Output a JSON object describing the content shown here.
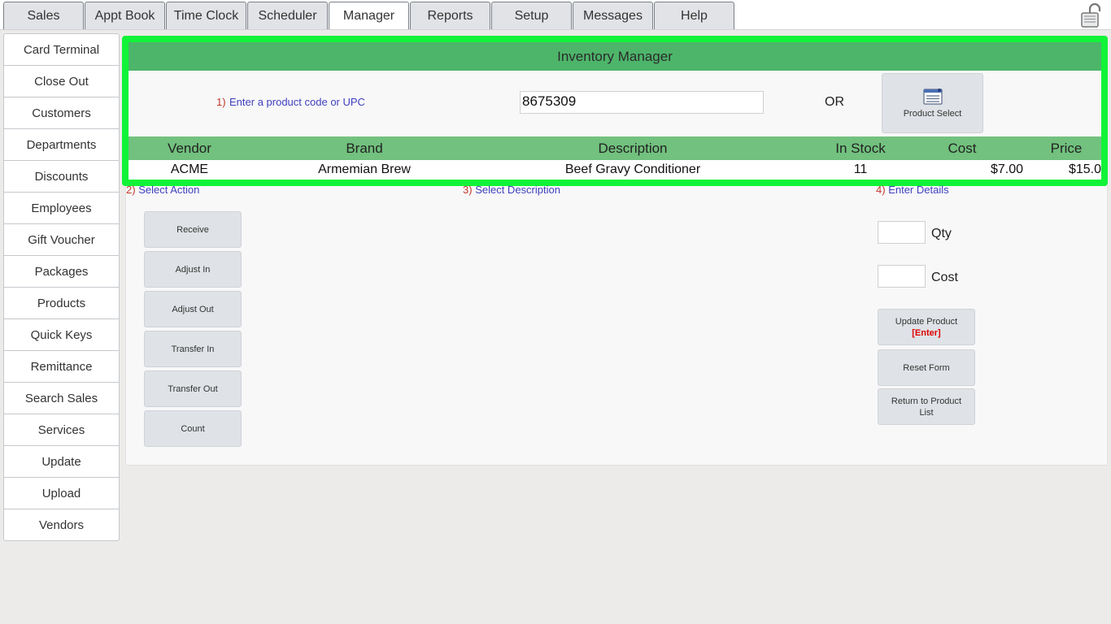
{
  "tabs": [
    {
      "label": "Sales",
      "active": false
    },
    {
      "label": "Appt Book",
      "active": false
    },
    {
      "label": "Time Clock",
      "active": false
    },
    {
      "label": "Scheduler",
      "active": false
    },
    {
      "label": "Manager",
      "active": true
    },
    {
      "label": "Reports",
      "active": false
    },
    {
      "label": "Setup",
      "active": false
    },
    {
      "label": "Messages",
      "active": false
    },
    {
      "label": "Help",
      "active": false
    }
  ],
  "sidebar": {
    "items": [
      {
        "label": "Card Terminal"
      },
      {
        "label": "Close Out"
      },
      {
        "label": "Customers"
      },
      {
        "label": "Departments"
      },
      {
        "label": "Discounts"
      },
      {
        "label": "Employees"
      },
      {
        "label": "Gift Voucher"
      },
      {
        "label": "Packages"
      },
      {
        "label": "Products"
      },
      {
        "label": "Quick Keys"
      },
      {
        "label": "Remittance"
      },
      {
        "label": "Search Sales"
      },
      {
        "label": "Services"
      },
      {
        "label": "Update"
      },
      {
        "label": "Upload"
      },
      {
        "label": "Vendors"
      }
    ]
  },
  "inventory": {
    "title": "Inventory Manager",
    "step1_num": "1)",
    "step1_text": "Enter a product code or UPC",
    "code_value": "8675309",
    "or_label": "OR",
    "product_select_label": "Product Select",
    "columns": {
      "vendor": "Vendor",
      "brand": "Brand",
      "description": "Description",
      "in_stock": "In Stock",
      "cost": "Cost",
      "price": "Price"
    },
    "row": {
      "vendor": "ACME",
      "brand": "Armemian Brew",
      "description": "Beef Gravy Conditioner",
      "in_stock": "11",
      "cost": "$7.00",
      "price": "$15.0"
    }
  },
  "steps": {
    "step2_num": "2)",
    "step2_text": "Select Action",
    "step3_num": "3)",
    "step3_text": "Select Description",
    "step4_num": "4)",
    "step4_text": "Enter Details"
  },
  "actions": [
    {
      "label": "Receive"
    },
    {
      "label": "Adjust In"
    },
    {
      "label": "Adjust Out"
    },
    {
      "label": "Transfer In"
    },
    {
      "label": "Transfer Out"
    },
    {
      "label": "Count"
    }
  ],
  "details": {
    "qty_label": "Qty",
    "cost_label": "Cost",
    "update_label": "Update Product",
    "update_hint": "[Enter]",
    "reset_label": "Reset Form",
    "return_label": "Return to Product List"
  },
  "colors": {
    "highlight_border": "#11f338",
    "title_bar": "#4db56a",
    "table_header": "#72c17e",
    "step_number": "#c0392b",
    "step_text": "#3f3fbf"
  },
  "icons": {
    "lock": "unlocked-padlock-icon",
    "product_select": "product-list-icon"
  }
}
